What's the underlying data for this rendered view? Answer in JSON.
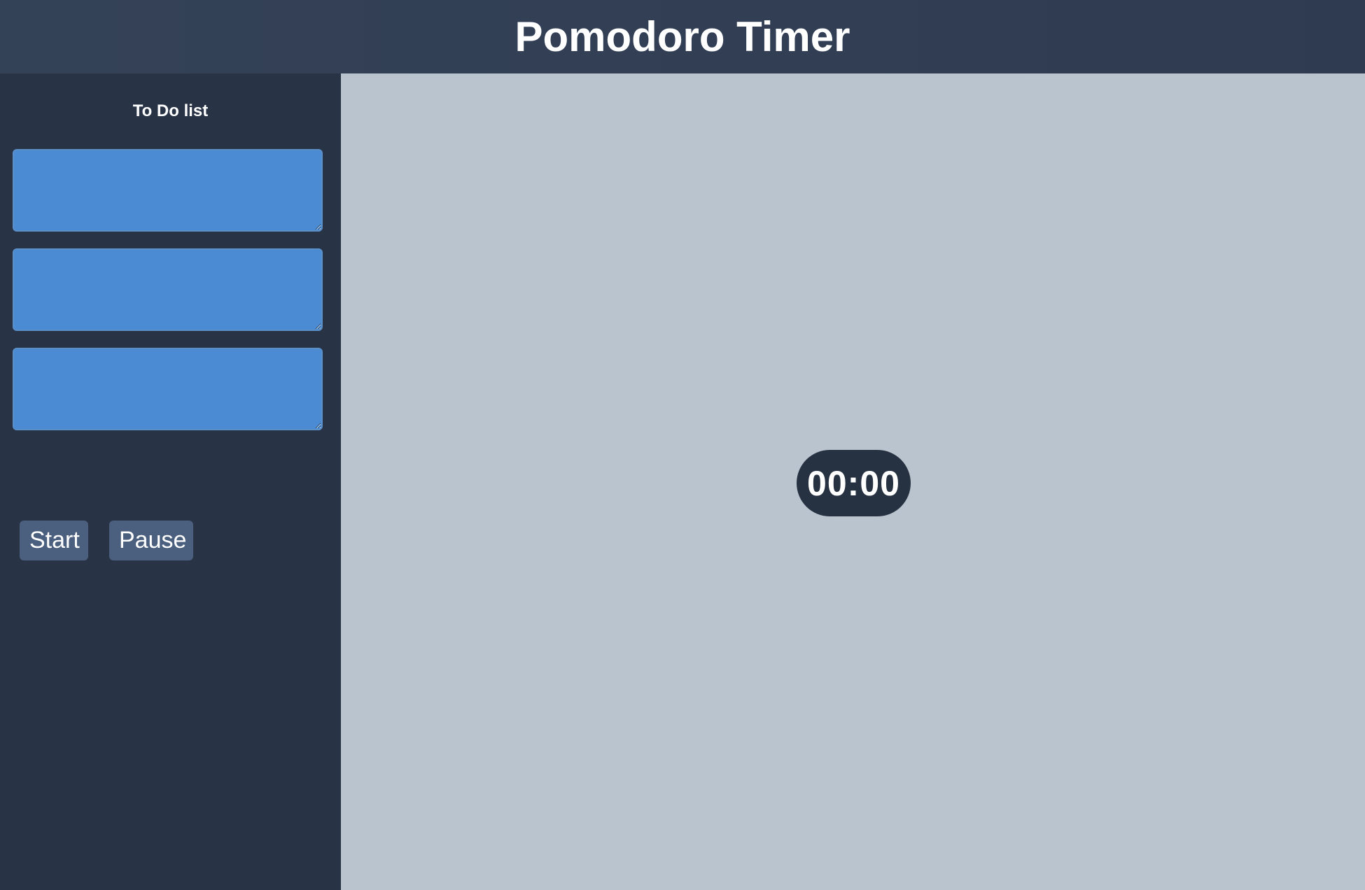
{
  "app": {
    "title": "Pomodoro Timer"
  },
  "sidebar": {
    "title": "To Do list",
    "todos": [
      {
        "value": "",
        "placeholder": ""
      },
      {
        "value": "",
        "placeholder": ""
      },
      {
        "value": "",
        "placeholder": ""
      }
    ],
    "controls": {
      "start_label": "Start",
      "pause_label": "Pause"
    }
  },
  "timer": {
    "display": "00:00"
  },
  "colors": {
    "header_bg": "#344258",
    "sidebar_bg": "#283446",
    "main_bg": "#bac4ce",
    "todo_field_bg": "#4a8bd4",
    "button_bg": "#4b5f7e",
    "timer_bg": "#263141",
    "text": "#ffffff"
  }
}
